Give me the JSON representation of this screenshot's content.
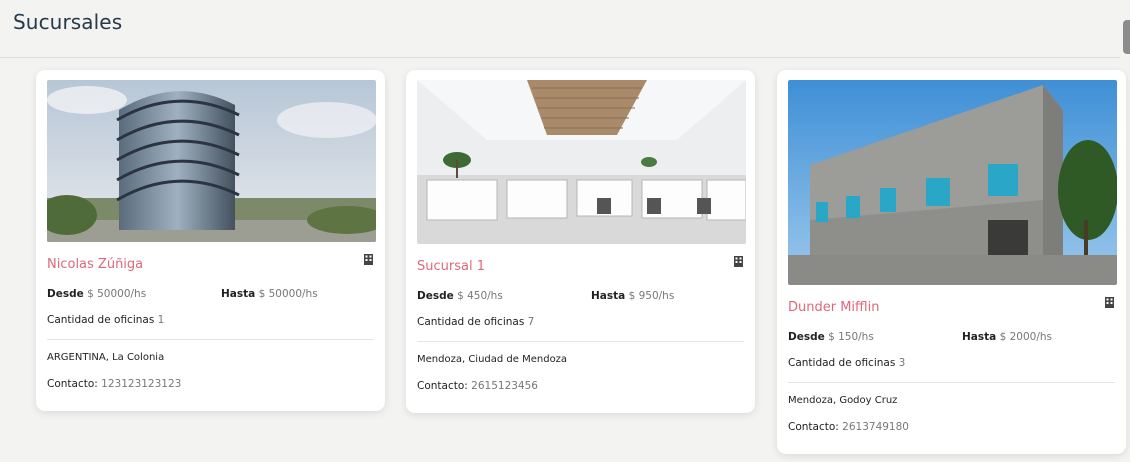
{
  "page": {
    "title": "Sucursales"
  },
  "labels": {
    "desde": "Desde",
    "hasta": "Hasta",
    "oficinas": "Cantidad de oficinas",
    "contacto": "Contacto:"
  },
  "branches": [
    {
      "name": "Nicolas Zúñiga",
      "desde": "$ 50000/hs",
      "hasta": "$ 50000/hs",
      "oficinas": "1",
      "location": "ARGENTINA, La Colonia",
      "contacto": "123123123123",
      "image": "modern-glass-tower-photo"
    },
    {
      "name": "Sucursal 1",
      "desde": "$ 450/hs",
      "hasta": "$ 950/hs",
      "oficinas": "7",
      "location": "Mendoza, Ciudad de Mendoza",
      "contacto": "2615123456",
      "image": "open-office-interior-photo"
    },
    {
      "name": "Dunder Mifflin",
      "desde": "$ 150/hs",
      "hasta": "$ 2000/hs",
      "oficinas": "3",
      "location": "Mendoza, Godoy Cruz",
      "contacto": "2613749180",
      "image": "concrete-warehouse-photo"
    }
  ],
  "colors": {
    "accent": "#e0677a",
    "title": "#26394a",
    "background": "#f3f3f1"
  },
  "icons": {
    "branch_type": "building-icon"
  }
}
